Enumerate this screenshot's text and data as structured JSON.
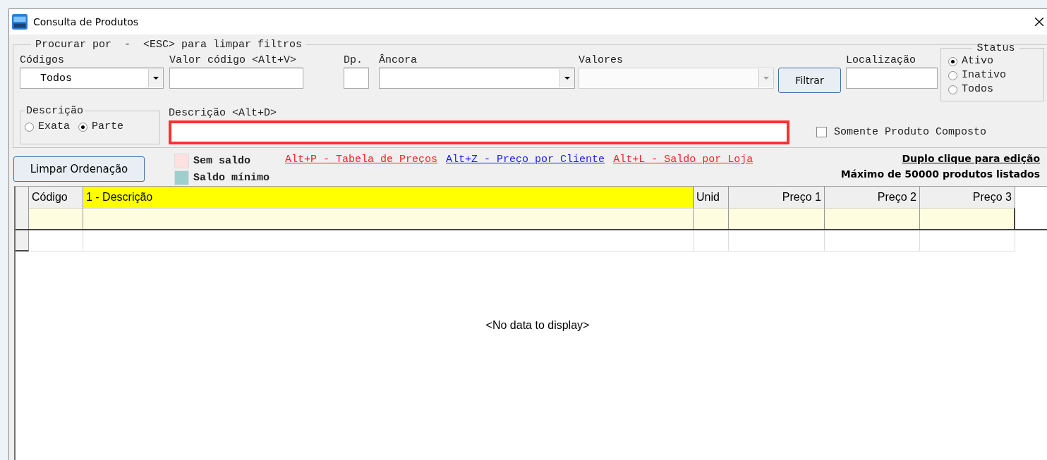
{
  "window": {
    "title": "Consulta de Produtos"
  },
  "filters": {
    "legend": "Procurar por  -  <ESC> para limpar filtros",
    "codigos": {
      "label": "Códigos",
      "value": "Todos"
    },
    "valor_codigo": {
      "label": "Valor código <Alt+V>"
    },
    "dp": {
      "label": "Dp."
    },
    "ancora": {
      "label": "Âncora"
    },
    "valores": {
      "label": "Valores",
      "disabled": true
    },
    "filter_button": "Filtrar",
    "localizacao": {
      "label": "Localização"
    },
    "status": {
      "legend": "Status",
      "options": [
        {
          "label": "Ativo",
          "selected": true
        },
        {
          "label": "Inativo",
          "selected": false
        },
        {
          "label": "Todos",
          "selected": false
        }
      ]
    },
    "descricao_mode": {
      "legend": "Descrição",
      "options": [
        {
          "label": "Exata",
          "selected": false
        },
        {
          "label": "Parte",
          "selected": true
        }
      ]
    },
    "descricao": {
      "label": "Descrição <Alt+D>",
      "highlighted": true
    },
    "composto": {
      "label": "Somente Produto Composto",
      "checked": false
    }
  },
  "toolbar": {
    "clear_button": "Limpar Ordenação",
    "legend": [
      {
        "label": "Sem saldo",
        "color": "#fde0e0"
      },
      {
        "label": "Saldo mínimo",
        "color": "#9ecfcc"
      }
    ],
    "shortcuts": [
      {
        "label": "Alt+P - Tabela de Preços",
        "color": "#ff2020"
      },
      {
        "label": "Alt+Z - Preço por Cliente",
        "color": "#1a1aff"
      },
      {
        "label": "Alt+L - Saldo por Loja",
        "color": "#ff2020"
      }
    ],
    "edit_hint": "Duplo clique para edição",
    "max_hint": "Máximo de 50000 produtos listados"
  },
  "grid": {
    "columns": [
      {
        "label": "Código",
        "selected": false
      },
      {
        "label": "1 - Descrição",
        "selected": true
      },
      {
        "label": "Unid",
        "selected": false
      },
      {
        "label": "Preço 1",
        "selected": false
      },
      {
        "label": "Preço 2",
        "selected": false
      },
      {
        "label": "Preço 3",
        "selected": false
      }
    ],
    "empty_text": "<No data to display>"
  }
}
